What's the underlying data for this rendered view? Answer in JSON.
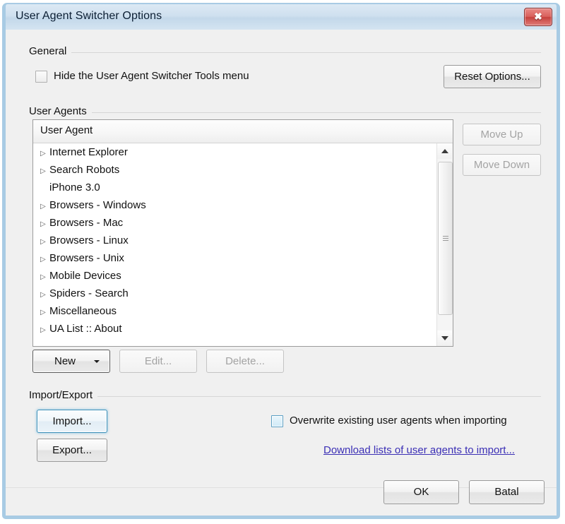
{
  "window": {
    "title": "User Agent Switcher Options",
    "close_glyph": "✖",
    "accent_border": "#a8cbe4",
    "titlebar_color": "#cfe0ef",
    "close_color": "#c6413d"
  },
  "general": {
    "legend": "General",
    "hide_menu_checkbox": {
      "label": "Hide the User Agent Switcher Tools menu",
      "checked": false
    },
    "reset_button": "Reset Options..."
  },
  "user_agents": {
    "legend": "User Agents",
    "column_header": "User Agent",
    "rows": [
      {
        "label": "Internet Explorer",
        "expandable": true
      },
      {
        "label": "Search Robots",
        "expandable": true
      },
      {
        "label": "iPhone 3.0",
        "expandable": false
      },
      {
        "label": "Browsers - Windows",
        "expandable": true
      },
      {
        "label": "Browsers - Mac",
        "expandable": true
      },
      {
        "label": "Browsers - Linux",
        "expandable": true
      },
      {
        "label": "Browsers - Unix",
        "expandable": true
      },
      {
        "label": "Mobile Devices",
        "expandable": true
      },
      {
        "label": "Spiders - Search",
        "expandable": true
      },
      {
        "label": "Miscellaneous",
        "expandable": true
      },
      {
        "label": "UA List :: About",
        "expandable": true
      }
    ],
    "expander_glyph": "▷",
    "move_up_button": {
      "label": "Move Up",
      "enabled": false
    },
    "move_down_button": {
      "label": "Move Down",
      "enabled": false
    },
    "new_button": {
      "label": "New",
      "enabled": true,
      "has_dropdown": true,
      "focused": true
    },
    "edit_button": {
      "label": "Edit...",
      "enabled": false
    },
    "delete_button": {
      "label": "Delete...",
      "enabled": false
    }
  },
  "import_export": {
    "legend": "Import/Export",
    "import_button": {
      "label": "Import...",
      "highlighted": true
    },
    "export_button": {
      "label": "Export..."
    },
    "overwrite_checkbox": {
      "label": "Overwrite existing user agents when importing",
      "checked": false,
      "hovered": true
    },
    "download_link": {
      "label": "Download lists of user agents to import...",
      "color": "#3b2fb5"
    }
  },
  "footer": {
    "ok_button": "OK",
    "cancel_button": "Batal"
  }
}
